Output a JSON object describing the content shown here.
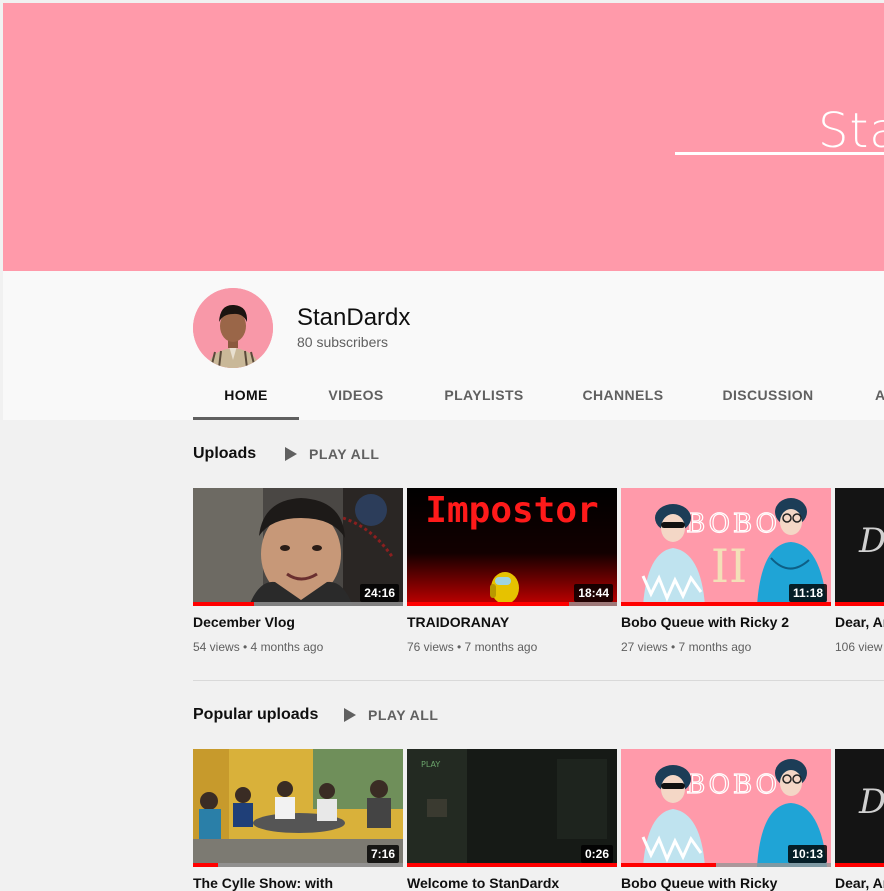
{
  "banner": {
    "text": "Stan"
  },
  "channel": {
    "name": "StanDardx",
    "subscribers": "80 subscribers"
  },
  "tabs": [
    "HOME",
    "VIDEOS",
    "PLAYLISTS",
    "CHANNELS",
    "DISCUSSION",
    "A"
  ],
  "active_tab": "HOME",
  "uploads": {
    "title": "Uploads",
    "play_all": "PLAY ALL",
    "videos": [
      {
        "title": "December Vlog",
        "meta": "54 views • 4 months ago",
        "duration": "24:16",
        "progress": 0.29
      },
      {
        "title": "TRAIDORANAY",
        "meta": "76 views • 7 months ago",
        "duration": "18:44",
        "progress": 0.77,
        "thumb_text": "Impostor"
      },
      {
        "title": "Bobo Queue with Ricky 2",
        "meta": "27 views • 7 months ago",
        "duration": "11:18",
        "progress": 1.0,
        "thumb_text": "BOBO",
        "thumb_sub": "II"
      },
      {
        "title": "Dear, Ar",
        "meta": "106 view",
        "progress": 1.0
      }
    ]
  },
  "popular": {
    "title": "Popular uploads",
    "play_all": "PLAY ALL",
    "videos": [
      {
        "title": "The Cylle Show: with",
        "duration": "7:16",
        "progress": 0.12
      },
      {
        "title": "Welcome to StanDardx",
        "duration": "0:26",
        "progress": 1.0,
        "thumb_text": "PLAY"
      },
      {
        "title": "Bobo Queue with Ricky",
        "duration": "10:13",
        "progress": 0.45,
        "thumb_text": "BOBO"
      },
      {
        "title": "Dear, Ar",
        "progress": 1.0
      }
    ]
  },
  "colors": {
    "banner": "#ff9aaa",
    "progress": "#ff0000"
  }
}
